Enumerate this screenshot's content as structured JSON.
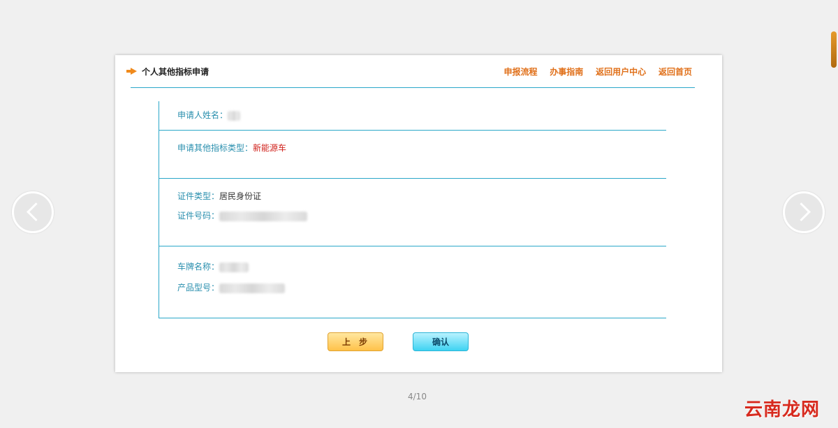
{
  "header": {
    "title": "个人其他指标申请",
    "links": [
      "申报流程",
      "办事指南",
      "返回用户中心",
      "返回首页"
    ]
  },
  "form": {
    "applicant": {
      "label": "申请人姓名："
    },
    "indicator": {
      "label": "申请其他指标类型：",
      "value": "新能源车"
    },
    "id_type": {
      "label": "证件类型：",
      "value": "居民身份证"
    },
    "id_number": {
      "label": "证件号码："
    },
    "brand": {
      "label": "车牌名称："
    },
    "model": {
      "label": "产品型号："
    }
  },
  "buttons": {
    "prev": "上步",
    "confirm": "确认"
  },
  "pager": "4/10",
  "watermark": "云南龙网",
  "colors": {
    "accent": "#2aa7c9",
    "link": "#e0701a",
    "value_red": "#d0201a"
  },
  "icons": [
    "arrow-right-icon",
    "chevron-left-icon",
    "chevron-right-icon"
  ]
}
